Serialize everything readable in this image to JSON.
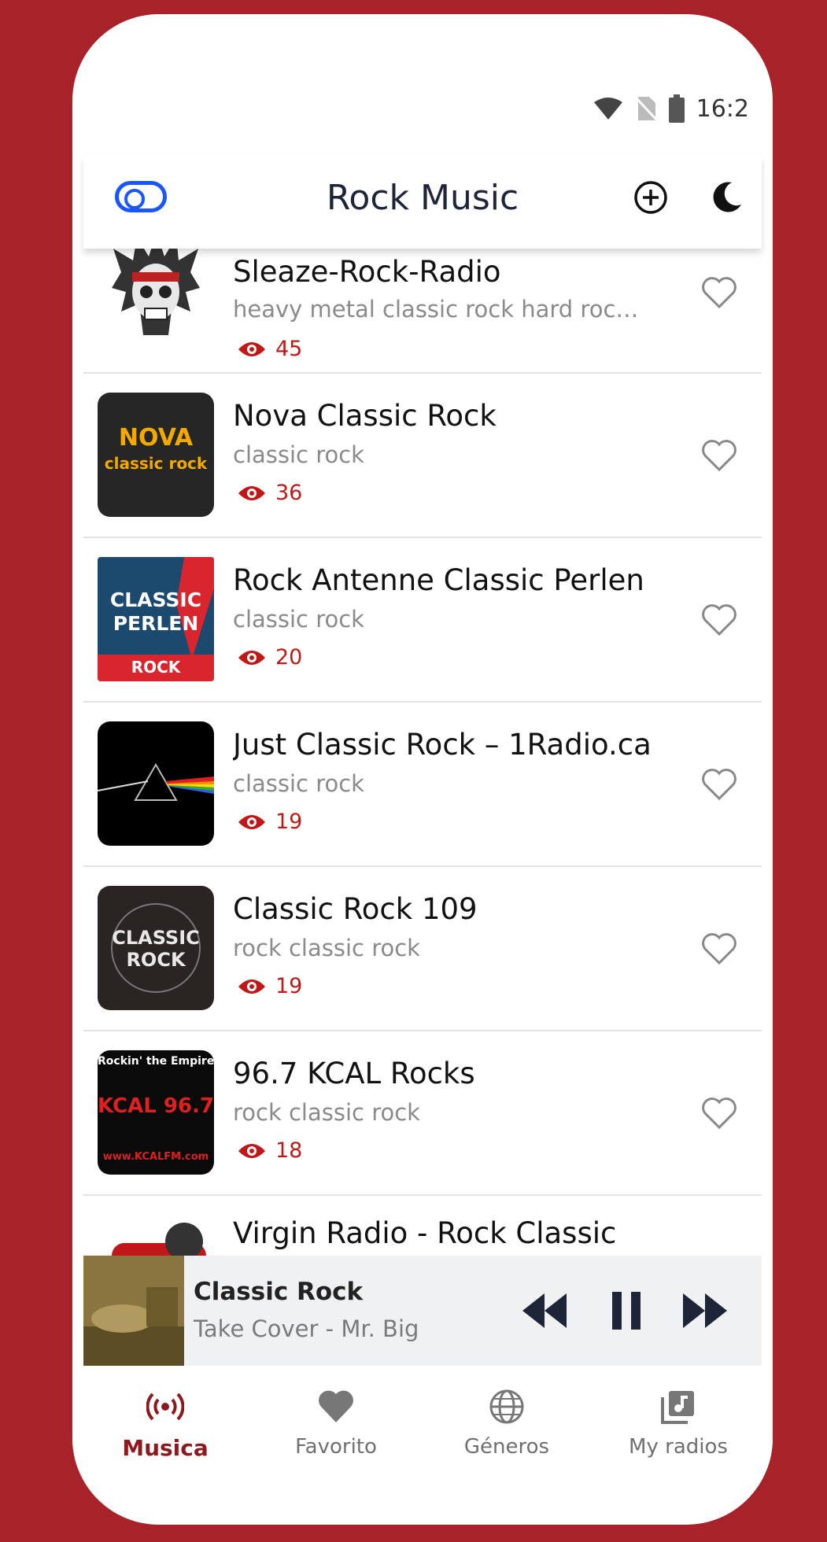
{
  "status": {
    "time": "16:2​"
  },
  "header": {
    "title": "Rock Music"
  },
  "stations": [
    {
      "name": "Sleaze-Rock-Radio",
      "genres": "heavy metal classic rock hard rock alt...",
      "views": "45"
    },
    {
      "name": "Nova Classic Rock",
      "genres": "classic rock",
      "views": "36",
      "logo_text_1": "NOVA",
      "logo_text_2": "classic rock"
    },
    {
      "name": "Rock Antenne Classic Perlen",
      "genres": "classic rock",
      "views": "20",
      "logo_text_1": "CLASSIC",
      "logo_text_2": "PERLEN",
      "logo_text_3": "ROCK"
    },
    {
      "name": "Just Classic Rock – 1Radio.ca",
      "genres": "classic rock",
      "views": "19"
    },
    {
      "name": "Classic Rock 109",
      "genres": "rock classic rock",
      "views": "19",
      "logo_text_1": "CLASSIC",
      "logo_text_2": "ROCK"
    },
    {
      "name": "96.7 KCAL Rocks",
      "genres": "rock classic rock",
      "views": "18",
      "logo_text_1": "Rockin' the Empire",
      "logo_text_2": "KCAL 96.7",
      "logo_text_3": "www.KCALFM.com"
    },
    {
      "name": "Virgin Radio - Rock Classic",
      "genres": "",
      "views": ""
    }
  ],
  "player": {
    "title": "Classic Rock",
    "subtitle": "Take Cover - Mr. Big"
  },
  "nav": [
    {
      "label": "Musica",
      "icon": "radio-icon",
      "active": true
    },
    {
      "label": "Favorito",
      "icon": "heart-icon",
      "active": false
    },
    {
      "label": "Géneros",
      "icon": "globe-icon",
      "active": false
    },
    {
      "label": "My radios",
      "icon": "music-library-icon",
      "active": false
    }
  ],
  "colors": {
    "background": "#a8222a",
    "accent": "#c01818",
    "active_nav": "#8b1a1f",
    "toggle": "#1a55ff"
  }
}
